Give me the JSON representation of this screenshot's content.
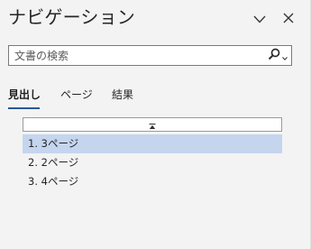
{
  "pane": {
    "title": "ナビゲーション",
    "options_icon": "chevron-down-icon",
    "close_icon": "close-icon"
  },
  "search": {
    "value": "",
    "placeholder": "文書の検索",
    "icon": "search-icon",
    "dropdown_icon": "chevron-down-icon"
  },
  "tabs": [
    {
      "label": "見出し",
      "active": true
    },
    {
      "label": "ページ",
      "active": false
    },
    {
      "label": "結果",
      "active": false
    }
  ],
  "headings": {
    "collapse_icon": "collapse-all-icon",
    "items": [
      {
        "label": "1. 3ページ",
        "selected": true
      },
      {
        "label": "2. 2ページ",
        "selected": false
      },
      {
        "label": "3. 4ページ",
        "selected": false
      }
    ]
  },
  "colors": {
    "pane_background": "#f3f3f3",
    "accent": "#2b579a",
    "selected_row": "#c5d5ee",
    "text": "#262626"
  }
}
